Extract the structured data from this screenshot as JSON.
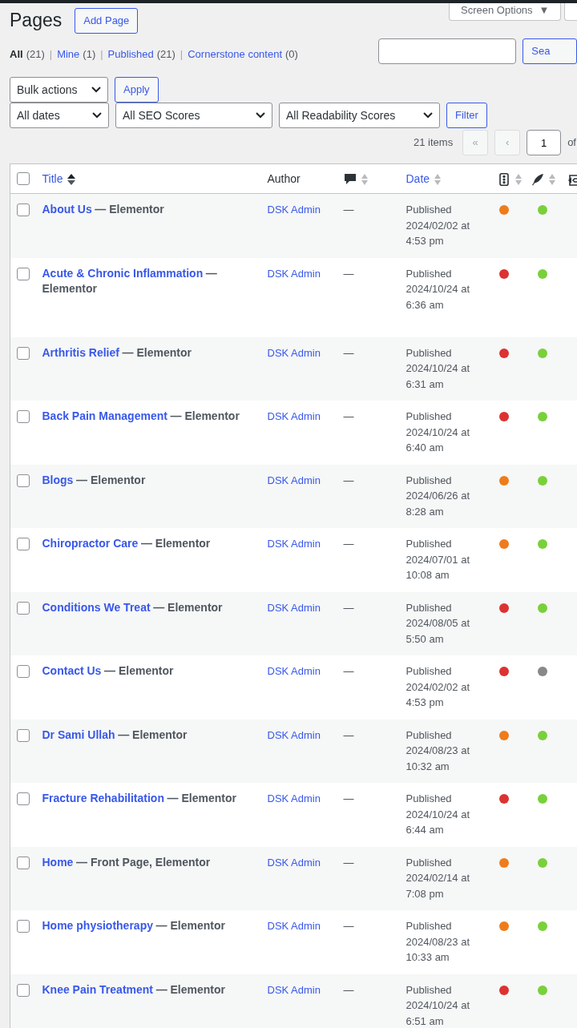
{
  "screen_options": {
    "label": "Screen Options",
    "caret": "▼"
  },
  "page_title": "Pages",
  "add_button": "Add Page",
  "views": [
    {
      "label": "All",
      "count": "(21)",
      "selected": true
    },
    {
      "separator": "|",
      "label": "Mine",
      "count": "(1)",
      "selected": false
    },
    {
      "separator": "|",
      "label": "Published",
      "count": "(21)",
      "selected": false
    },
    {
      "separator": "|",
      "label": "Cornerstone content",
      "count": "(0)",
      "selected": false
    }
  ],
  "search": {
    "button": "Sea"
  },
  "bulk_actions": {
    "value": "Bulk actions",
    "apply": "Apply"
  },
  "filters": [
    {
      "value": "All dates"
    },
    {
      "value": "All SEO Scores"
    },
    {
      "value": "All Readability Scores"
    }
  ],
  "filter_button": "Filter",
  "pagination": {
    "count": "21 items",
    "first": "«",
    "prev": "‹",
    "page": "1",
    "of": "of",
    "first_disabled": true,
    "prev_disabled": true
  },
  "columns": [
    {
      "kind": "title",
      "label": "Title",
      "sortable": true,
      "sorted": true
    },
    {
      "kind": "text",
      "label": "Author"
    },
    {
      "kind": "comments",
      "sortable": true,
      "sorted": false
    },
    {
      "kind": "title",
      "label": "Date",
      "sortable": true,
      "sorted": false
    },
    {
      "kind": "seo",
      "sortable": true,
      "sorted": false
    },
    {
      "kind": "readability",
      "sortable": true,
      "sorted": false
    },
    {
      "kind": "links"
    }
  ],
  "select_all_checked": false,
  "rows": [
    {
      "checked": false,
      "title": "About Us",
      "state": "— Elementor",
      "author": "DSK Admin",
      "comments": "—",
      "status": "Published",
      "date": "2024/02/02 at 4:53 pm",
      "seo": {
        "color": "#ee7c1b"
      },
      "readability": {
        "color": "#7ad03a"
      }
    },
    {
      "checked": false,
      "title": "Acute & Chronic Inflammation",
      "state": "— Elementor",
      "author": "DSK Admin",
      "comments": "—",
      "status": "Published",
      "date": "2024/10/24 at 6:36 am",
      "seo": {
        "color": "#dc3232"
      },
      "readability": {
        "color": "#7ad03a"
      }
    },
    {
      "checked": false,
      "title": "Arthritis Relief",
      "state": "— Elementor",
      "author": "DSK Admin",
      "comments": "—",
      "status": "Published",
      "date": "2024/10/24 at 6:31 am",
      "seo": {
        "color": "#dc3232"
      },
      "readability": {
        "color": "#7ad03a"
      }
    },
    {
      "checked": false,
      "title": "Back Pain Management",
      "state": "— Elementor",
      "author": "DSK Admin",
      "comments": "—",
      "status": "Published",
      "date": "2024/10/24 at 6:40 am",
      "seo": {
        "color": "#dc3232"
      },
      "readability": {
        "color": "#7ad03a"
      }
    },
    {
      "checked": false,
      "title": "Blogs",
      "state": "— Elementor",
      "author": "DSK Admin",
      "comments": "—",
      "status": "Published",
      "date": "2024/06/26 at 8:28 am",
      "seo": {
        "color": "#ee7c1b"
      },
      "readability": {
        "color": "#7ad03a"
      }
    },
    {
      "checked": false,
      "title": "Chiropractor Care",
      "state": "— Elementor",
      "author": "DSK Admin",
      "comments": "—",
      "status": "Published",
      "date": "2024/07/01 at 10:08 am",
      "seo": {
        "color": "#ee7c1b"
      },
      "readability": {
        "color": "#7ad03a"
      }
    },
    {
      "checked": false,
      "title": "Conditions We Treat",
      "state": "— Elementor",
      "author": "DSK Admin",
      "comments": "—",
      "status": "Published",
      "date": "2024/08/05 at 5:50 am",
      "seo": {
        "color": "#dc3232"
      },
      "readability": {
        "color": "#7ad03a"
      }
    },
    {
      "checked": false,
      "title": "Contact Us",
      "state": "— Elementor",
      "author": "DSK Admin",
      "comments": "—",
      "status": "Published",
      "date": "2024/02/02 at 4:53 pm",
      "seo": {
        "color": "#dc3232"
      },
      "readability": {
        "color": "#888888"
      }
    },
    {
      "checked": false,
      "title": "Dr Sami Ullah",
      "state": "— Elementor",
      "author": "DSK Admin",
      "comments": "—",
      "status": "Published",
      "date": "2024/08/23 at 10:32 am",
      "seo": {
        "color": "#ee7c1b"
      },
      "readability": {
        "color": "#7ad03a"
      }
    },
    {
      "checked": false,
      "title": "Fracture Rehabilitation",
      "state": "— Elementor",
      "author": "DSK Admin",
      "comments": "—",
      "status": "Published",
      "date": "2024/10/24 at 6:44 am",
      "seo": {
        "color": "#dc3232"
      },
      "readability": {
        "color": "#7ad03a"
      }
    },
    {
      "checked": false,
      "title": "Home",
      "state": "— Front Page, Elementor",
      "author": "DSK Admin",
      "comments": "—",
      "status": "Published",
      "date": "2024/02/14 at 7:08 pm",
      "seo": {
        "color": "#ee7c1b"
      },
      "readability": {
        "color": "#7ad03a"
      }
    },
    {
      "checked": false,
      "title": "Home physiotherapy",
      "state": "— Elementor",
      "author": "DSK Admin",
      "comments": "—",
      "status": "Published",
      "date": "2024/08/23 at 10:33 am",
      "seo": {
        "color": "#ee7c1b"
      },
      "readability": {
        "color": "#7ad03a"
      }
    },
    {
      "checked": false,
      "title": "Knee Pain Treatment",
      "state": "— Elementor",
      "author": "DSK Admin",
      "comments": "—",
      "status": "Published",
      "date": "2024/10/24 at 6:51 am",
      "seo": {
        "color": "#dc3232"
      },
      "readability": {
        "color": "#7ad03a"
      }
    }
  ]
}
